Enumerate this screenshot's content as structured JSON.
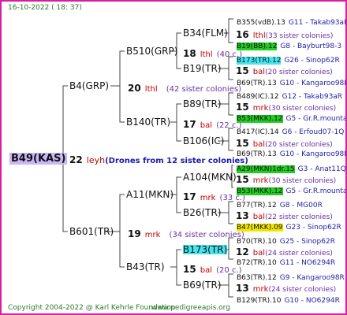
{
  "header": {
    "date": "16-10-2022 ( 18: 37)"
  },
  "root": {
    "name": "B49(KAS)",
    "count": "22",
    "breeder": "leyh",
    "note": "(Drones from 12 sister colonies)"
  },
  "gen1": [
    {
      "name": "B4(GRP)",
      "count": "20",
      "breeder": "lthl",
      "colonies": "(42 sister colonies)"
    },
    {
      "name": "B601(TR)",
      "count": "19",
      "breeder": "mrk",
      "colonies": "(34 sister colonies)"
    }
  ],
  "gen2": [
    {
      "name": "B510(GRP)",
      "count": "18",
      "breeder": "lthl",
      "colonies": "(40 c.)"
    },
    {
      "name": "B140(TR)",
      "count": "17",
      "breeder": "bal",
      "colonies": "(22 c.)"
    },
    {
      "name": "A11(MKN)",
      "count": "17",
      "breeder": "mrk",
      "colonies": "(33 c.)"
    },
    {
      "name": "B43(TR)",
      "count": "15",
      "breeder": "bal",
      "colonies": "(20 c.)"
    }
  ],
  "gen3": [
    {
      "name": "B34(FLM)",
      "count": "16",
      "breeder": "lthl",
      "colonies": "(33 sister colonies)"
    },
    {
      "name": "B19(TR)",
      "count": "15",
      "breeder": "bal",
      "colonies": "(20 sister colonies)"
    },
    {
      "name": "B89(TR)",
      "count": "15",
      "breeder": "mrk",
      "colonies": "(30 sister colonies)"
    },
    {
      "name": "B106(IC)",
      "count": "15",
      "breeder": "bal",
      "colonies": "(20 sister colonies)"
    },
    {
      "name": "A104(MKN)",
      "count": "15",
      "breeder": "mrk",
      "colonies": "(30 sister colonies)"
    },
    {
      "name": "B26(TR)",
      "count": "13",
      "breeder": "bal",
      "colonies": "(22 sister colonies)"
    },
    {
      "name": "B173(TR)",
      "count": "12",
      "breeder": "bal",
      "colonies": "(24 sister colonies)"
    },
    {
      "name": "B69(TR)",
      "count": "13",
      "breeder": "mrk",
      "colonies": "(24 sister colonies)"
    }
  ],
  "gen4": [
    {
      "name": "B355(vdB).13",
      "src": "G11 - Takab93aR",
      "hl": ""
    },
    {
      "name": "B19(BB).12",
      "src": "G8 - Bayburt98-3",
      "hl": "green"
    },
    {
      "name": "B173(TR).12",
      "src": "G26 - Sinop62R",
      "hl": "cyan"
    },
    {
      "name": "B69(TR).13",
      "src": "G10 - Kangaroo98R",
      "hl": ""
    },
    {
      "name": "B489(IC).12",
      "src": "G12 - Takab93aR",
      "hl": ""
    },
    {
      "name": "B53(MKK).12",
      "src": "G5 - Gr.R.mounta",
      "hl": "green"
    },
    {
      "name": "B417(IC).14",
      "src": "G6 - Erfoud07-1Q",
      "hl": ""
    },
    {
      "name": "B69(TR).13",
      "src": "G10 - Kangaroo98R",
      "hl": ""
    },
    {
      "name": "A29(MKN)1dr.15",
      "src": "G3 - Anat11Q",
      "hl": "green"
    },
    {
      "name": "B53(MKK).12",
      "src": "G5 - Gr.R.mounta",
      "hl": "green"
    },
    {
      "name": "B77(TR).12",
      "src": "G8 - MG00R",
      "hl": ""
    },
    {
      "name": "B47(MKK).09",
      "src": "G23 - Sinop62R",
      "hl": "yellow"
    },
    {
      "name": "B70(TR).10",
      "src": "G25 - Sinop62R",
      "hl": ""
    },
    {
      "name": "B72(TR).10",
      "src": "G11 - NO6294R",
      "hl": ""
    },
    {
      "name": "B63(TR).12",
      "src": "G9 - Kangaroo98R",
      "hl": ""
    },
    {
      "name": "B129(TR).10",
      "src": "G10 - NO6294R",
      "hl": ""
    }
  ],
  "footer": {
    "copyright": "Copyright 2004-2022 @ Karl Kehrle Foundation",
    "site": "www.pedigreeapis.org"
  }
}
